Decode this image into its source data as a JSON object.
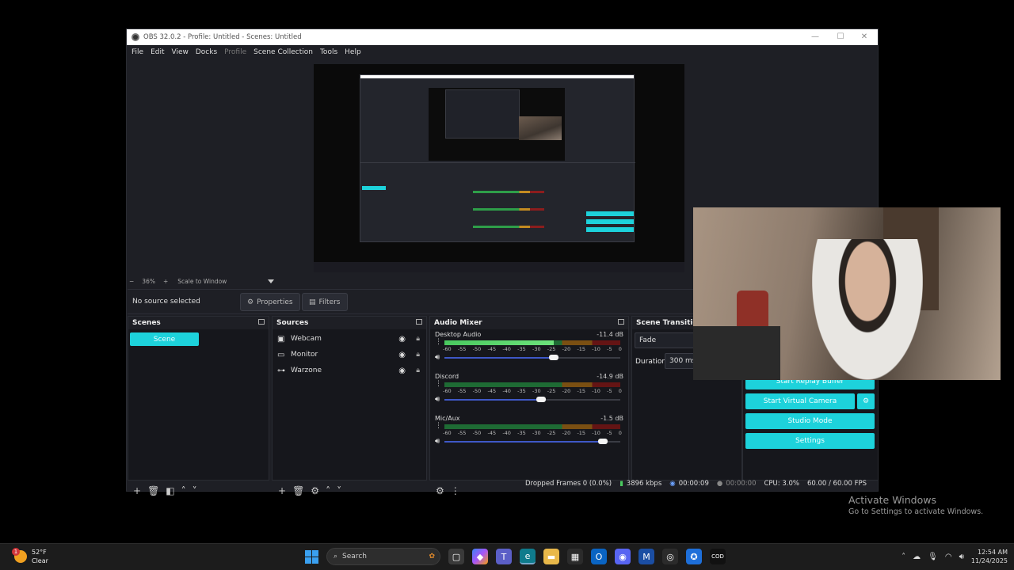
{
  "window": {
    "title": "OBS 32.0.2 - Profile: Untitled - Scenes: Untitled",
    "controls": {
      "minimize": "—",
      "maximize": "☐",
      "close": "✕"
    }
  },
  "menu": [
    "File",
    "Edit",
    "View",
    "Docks",
    "Profile",
    "Scene Collection",
    "Tools",
    "Help"
  ],
  "preview": {
    "zoom_minus": "−",
    "zoom_level": "36%",
    "zoom_plus": "+",
    "scale_label": "Scale to Window"
  },
  "context": {
    "no_source": "No source selected",
    "properties": "Properties",
    "filters": "Filters"
  },
  "scenes": {
    "header": "Scenes",
    "items": [
      "Scene"
    ]
  },
  "sources": {
    "header": "Sources",
    "items": [
      {
        "name": "Webcam",
        "icon": "camera-icon"
      },
      {
        "name": "Monitor",
        "icon": "monitor-icon"
      },
      {
        "name": "Warzone",
        "icon": "gamepad-icon"
      }
    ]
  },
  "mixer": {
    "header": "Audio Mixer",
    "ticks": [
      "-60",
      "-55",
      "-50",
      "-45",
      "-40",
      "-35",
      "-30",
      "-25",
      "-20",
      "-15",
      "-10",
      "-5",
      "0"
    ],
    "channels": [
      {
        "name": "Desktop Audio",
        "db": "-11.4 dB",
        "level": 0.62,
        "volume": 0.62
      },
      {
        "name": "Discord",
        "db": "-14.9 dB",
        "level": 0.0,
        "volume": 0.55
      },
      {
        "name": "Mic/Aux",
        "db": "-1.5 dB",
        "level": 0.0,
        "volume": 0.9
      }
    ]
  },
  "transitions": {
    "header": "Scene Transition",
    "type": "Fade",
    "duration_label": "Duration",
    "duration_value": "300 ms"
  },
  "controls": {
    "replay": "Start Replay Buffer",
    "virtual_cam": "Start Virtual Camera",
    "studio": "Studio Mode",
    "settings": "Settings"
  },
  "status": {
    "dropped": "Dropped Frames 0 (0.0%)",
    "bitrate": "3896 kbps",
    "stream_time": "00:00:09",
    "rec_time": "00:00:00",
    "cpu": "CPU: 3.0%",
    "fps": "60.00 / 60.00 FPS"
  },
  "watermark": {
    "line1": "Activate Windows",
    "line2": "Go to Settings to activate Windows."
  },
  "taskbar": {
    "weather_temp": "52°F",
    "weather_desc": "Clear",
    "weather_badge": "1",
    "search": "Search",
    "time": "12:54 AM",
    "date": "11/24/2025"
  },
  "colors": {
    "accent": "#1dd2db",
    "meter_green": "#4ac95f",
    "slider_blue": "#3f58c7"
  }
}
